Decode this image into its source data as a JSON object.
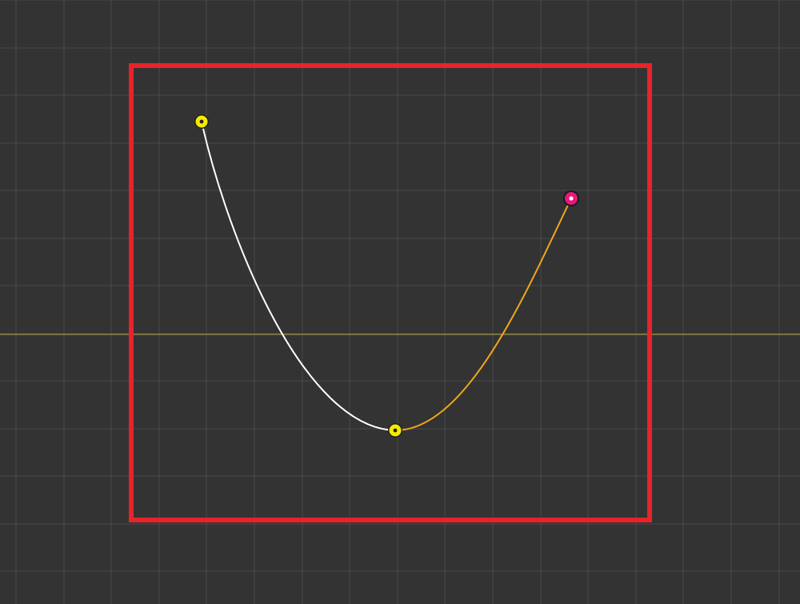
{
  "editor": {
    "colors": {
      "background": "#333333",
      "grid": "#4a4a4a",
      "horizon": "#b5a446",
      "frame": "#e8232a",
      "segment_before": "#ffffff",
      "segment_after": "#f0a61c",
      "keyframe_default": "#f5ea00",
      "keyframe_selected": "#e8197a"
    },
    "keyframes": [
      {
        "name": "keyframe-start",
        "state": "default"
      },
      {
        "name": "keyframe-middle",
        "state": "default"
      },
      {
        "name": "keyframe-end",
        "state": "selected"
      }
    ],
    "segments": [
      {
        "name": "curve-segment-1",
        "color_key": "segment_before"
      },
      {
        "name": "curve-segment-2",
        "color_key": "segment_after"
      }
    ]
  }
}
